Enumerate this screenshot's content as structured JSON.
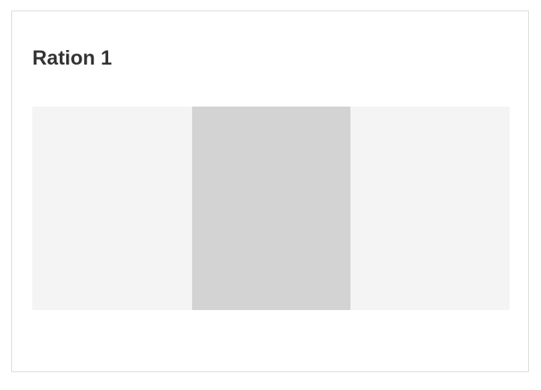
{
  "card": {
    "title": "Ration 1"
  },
  "panels": [
    {
      "color": "#f4f4f4"
    },
    {
      "color": "#d3d3d3"
    },
    {
      "color": "#f4f4f4"
    }
  ]
}
